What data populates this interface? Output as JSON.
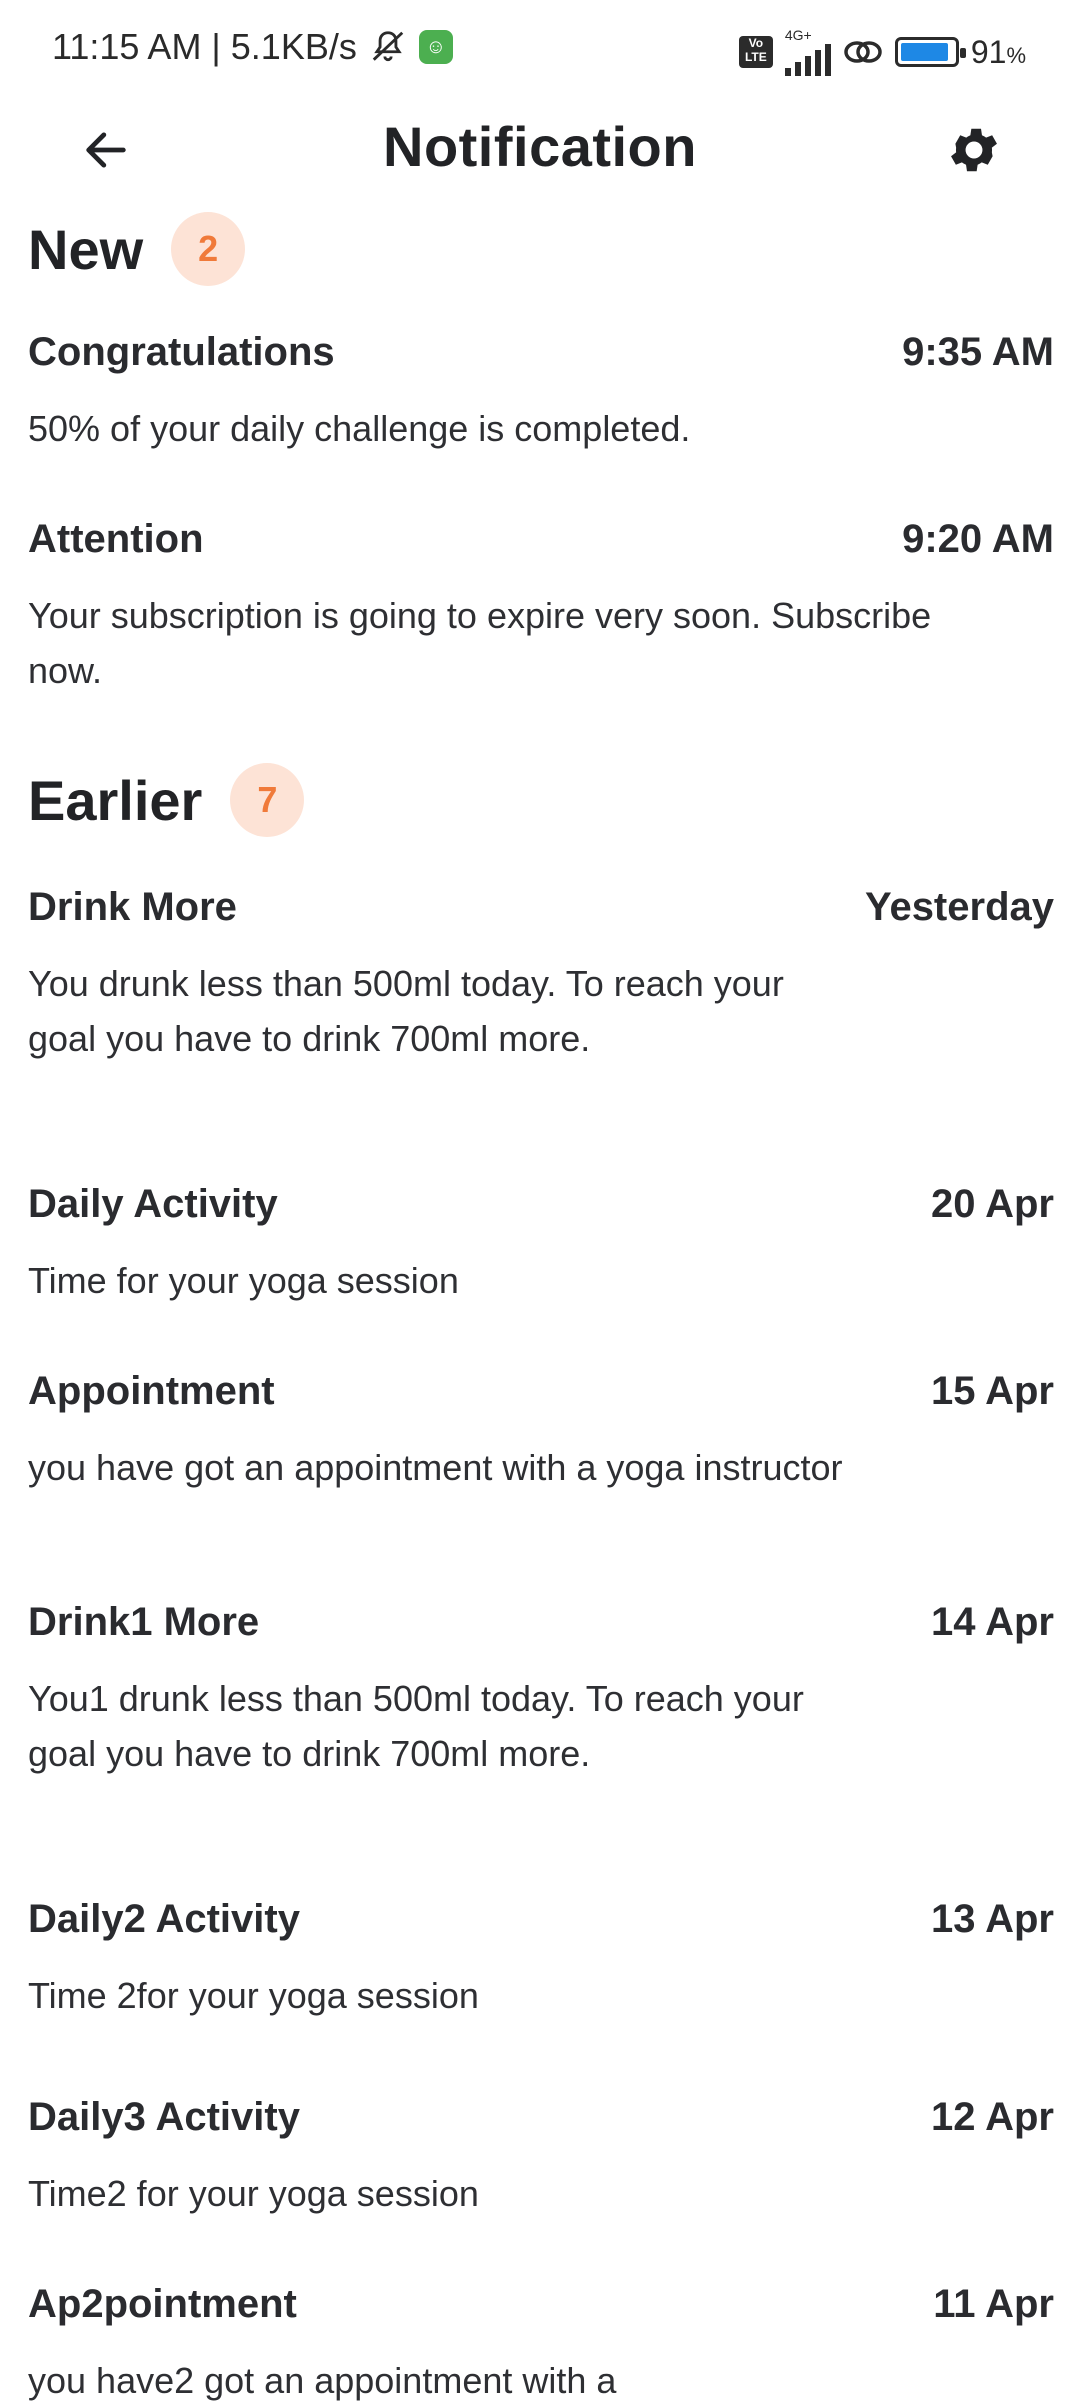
{
  "status_bar": {
    "time_speed": "11:15 AM | 5.1KB/s",
    "network": "4G+",
    "volte": "Vo LTE",
    "battery_level": 0.91,
    "battery_text": "91",
    "battery_unit": "%"
  },
  "header": {
    "title": "Notification"
  },
  "sections": {
    "new": {
      "title": "New",
      "count": "2",
      "items": [
        {
          "title": "Congratulations",
          "time": "9:35 AM",
          "body": "50% of your daily challenge is completed."
        },
        {
          "title": "Attention",
          "time": "9:20 AM",
          "body": "Your subscription is going to expire very soon. Subscribe now."
        }
      ]
    },
    "earlier": {
      "title": "Earlier",
      "count": "7",
      "items": [
        {
          "title": "Drink More",
          "time": "Yesterday",
          "body": "You drunk less than 500ml today. To reach your goal you have to drink 700ml more."
        },
        {
          "title": "Daily Activity",
          "time": "20 Apr",
          "body": "Time for your yoga session"
        },
        {
          "title": "Appointment",
          "time": "15 Apr",
          "body": "you have got an appointment with a yoga instructor"
        },
        {
          "title": "Drink1 More",
          "time": "14 Apr",
          "body": "You1 drunk less than 500ml today. To reach your goal you have to drink 700ml more."
        },
        {
          "title": "Daily2 Activity",
          "time": "13 Apr",
          "body": "Time 2for your yoga session"
        },
        {
          "title": "Daily3 Activity",
          "time": "12 Apr",
          "body": "Time2 for your yoga session"
        },
        {
          "title": "Ap2pointment",
          "time": "11 Apr",
          "body": "you have2 got an appointment with a"
        }
      ]
    }
  },
  "colors": {
    "badge_bg": "#fde3d6",
    "badge_text": "#f07a3a",
    "text": "#222326"
  }
}
